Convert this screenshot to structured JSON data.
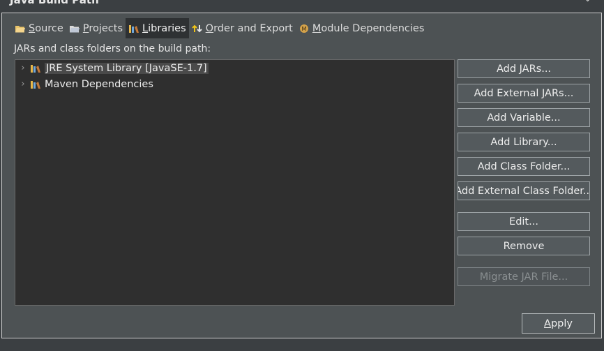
{
  "window": {
    "title": "Java Build Path"
  },
  "tabs": [
    {
      "label": "Source",
      "icon": "source-folder-icon"
    },
    {
      "label": "Projects",
      "icon": "projects-folder-icon"
    },
    {
      "label": "Libraries",
      "icon": "libraries-icon",
      "active": true
    },
    {
      "label": "Order and Export",
      "icon": "order-export-icon"
    },
    {
      "label": "Module Dependencies",
      "icon": "module-icon"
    }
  ],
  "pane_label": "JARs and class folders on the build path:",
  "tree": [
    {
      "label": "JRE System Library [JavaSE-1.7]",
      "selected": true
    },
    {
      "label": "Maven Dependencies",
      "selected": false
    }
  ],
  "buttons": [
    {
      "label": "Add JARs...",
      "enabled": true
    },
    {
      "label": "Add External JARs...",
      "enabled": true
    },
    {
      "label": "Add Variable...",
      "enabled": true
    },
    {
      "label": "Add Library...",
      "enabled": true
    },
    {
      "label": "Add Class Folder...",
      "enabled": true
    },
    {
      "label": "Add External Class Folder...",
      "enabled": true
    },
    {
      "label": "Edit...",
      "enabled": true
    },
    {
      "label": "Remove",
      "enabled": true
    },
    {
      "label": "Migrate JAR File...",
      "enabled": false
    }
  ],
  "apply_label": "Apply"
}
